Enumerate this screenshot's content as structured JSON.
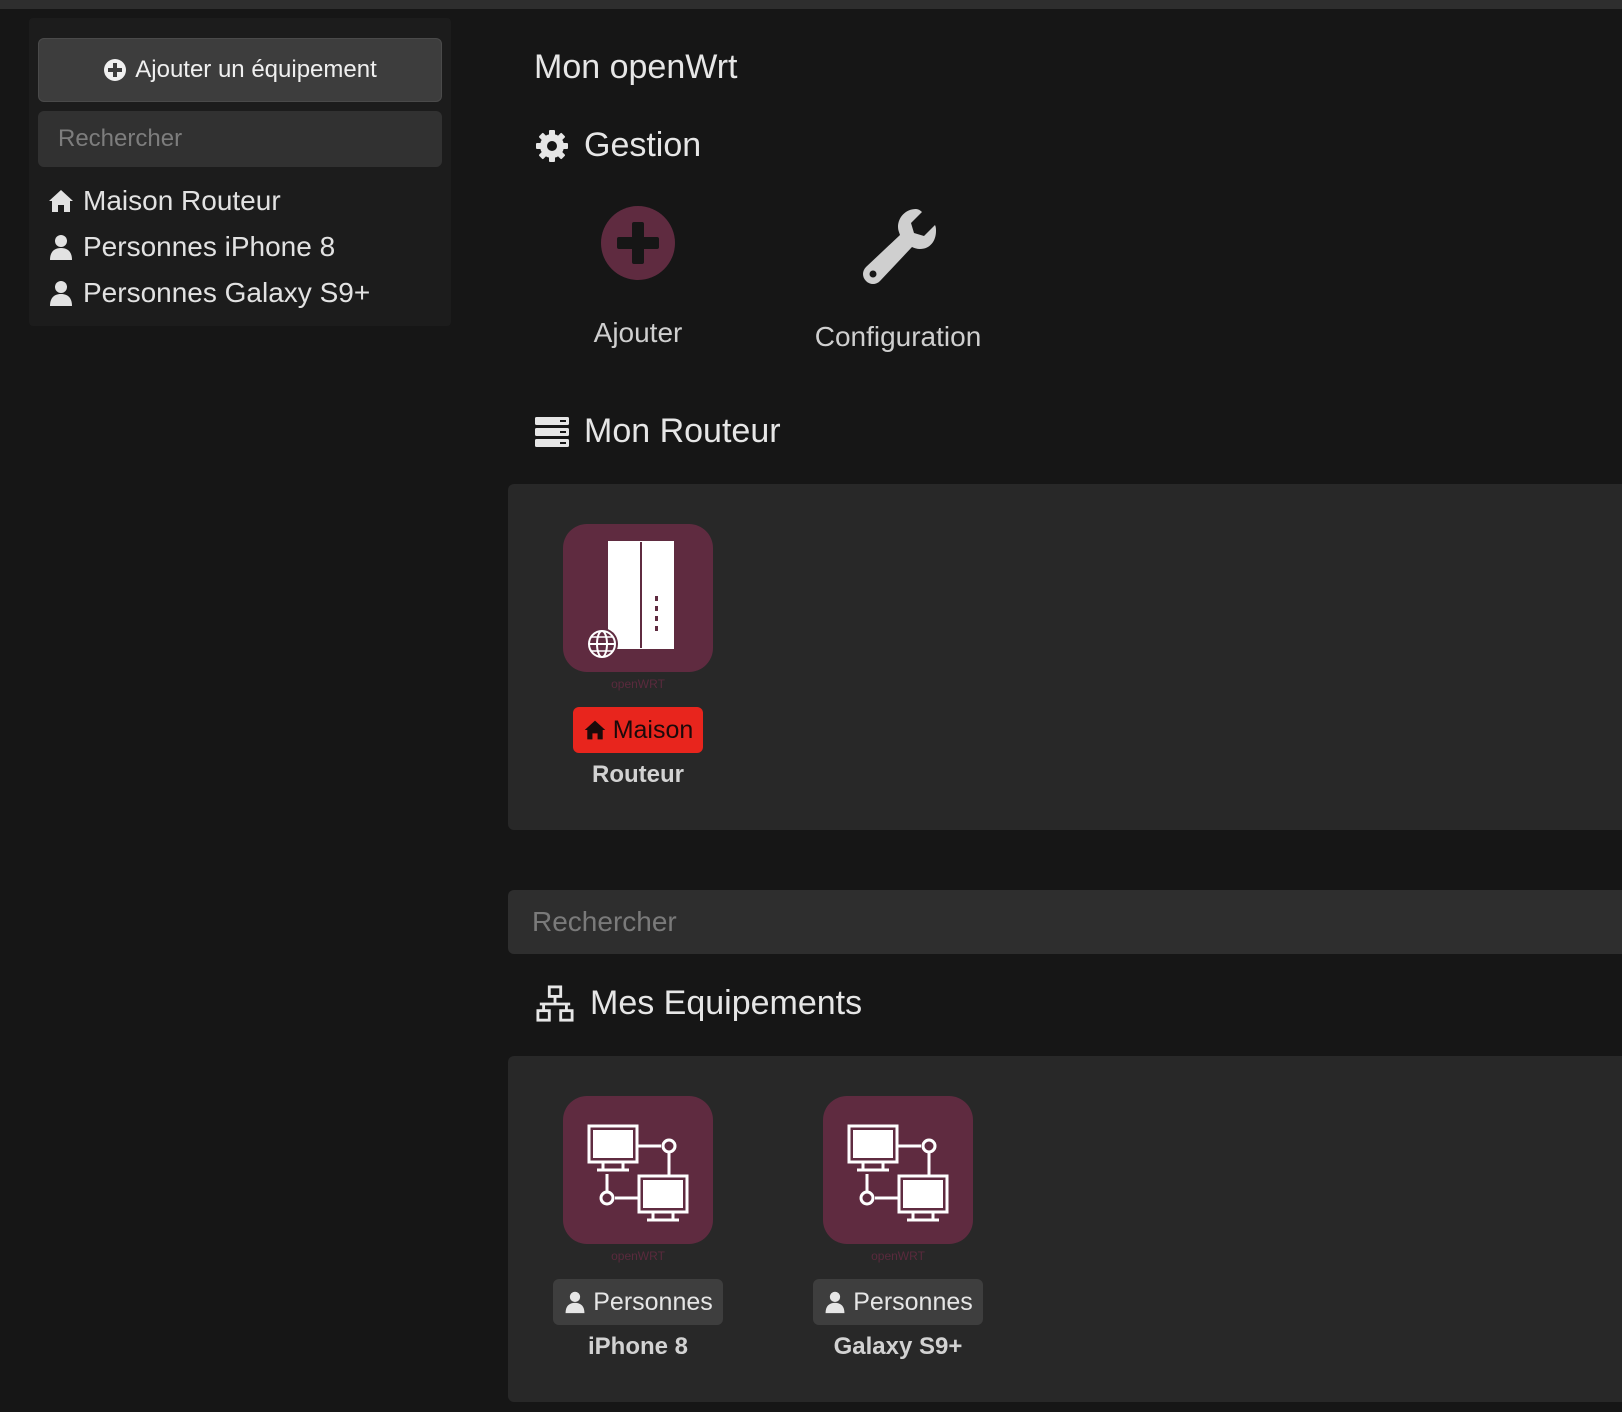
{
  "sidebar": {
    "add_button": "Ajouter un équipement",
    "search_placeholder": "Rechercher",
    "items": [
      {
        "icon": "home-icon",
        "label": "Maison Routeur"
      },
      {
        "icon": "user-icon",
        "label": "Personnes iPhone 8"
      },
      {
        "icon": "user-icon",
        "label": "Personnes Galaxy S9+"
      }
    ]
  },
  "main": {
    "title": "Mon openWrt",
    "management": {
      "title": "Gestion",
      "icon": "gear-icon",
      "add_label": "Ajouter",
      "config_label": "Configuration"
    },
    "router_section": {
      "title": "Mon Routeur",
      "icon": "server-icon",
      "card": {
        "brand": "openWRT",
        "badge": "Maison",
        "name": "Routeur"
      }
    },
    "search_placeholder": "Rechercher",
    "devices_section": {
      "title": "Mes Equipements",
      "icon": "network-icon",
      "cards": [
        {
          "brand": "openWRT",
          "badge": "Personnes",
          "name": "iPhone 8"
        },
        {
          "brand": "openWRT",
          "badge": "Personnes",
          "name": "Galaxy S9+"
        }
      ]
    }
  },
  "colors": {
    "background": "#161616",
    "accent_tile": "#5f2b40",
    "badge_red": "#e8251d"
  }
}
